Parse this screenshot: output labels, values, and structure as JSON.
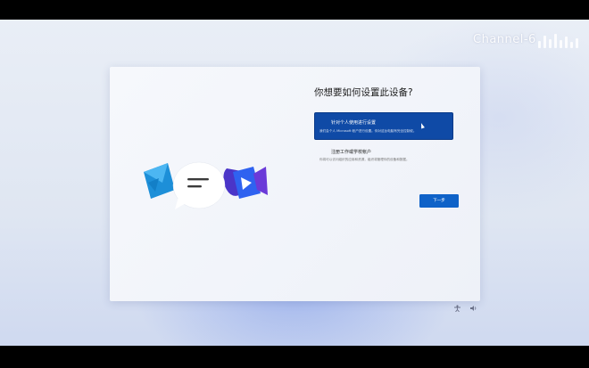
{
  "watermark": {
    "channel": "Channel-6"
  },
  "setup": {
    "question": "你想要如何设置此设备?",
    "options": [
      {
        "title": "针对个人使用进行设置",
        "description": "我们会个人 Microsoft 帐户进行设置。你对这台电脑有完全控制权。",
        "selected": true
      },
      {
        "title": "注册工作或学校帐户",
        "description": "你将可以访问组织的应用和资源，组织将管理你的设备和数据。",
        "selected": false
      }
    ],
    "next_label": "下一步"
  },
  "taskbar": {
    "accessibility_icon": "accessibility-icon",
    "volume_icon": "volume-icon"
  },
  "colors": {
    "selected_option": "#0f4aa6",
    "next_button": "#0f62c8"
  }
}
